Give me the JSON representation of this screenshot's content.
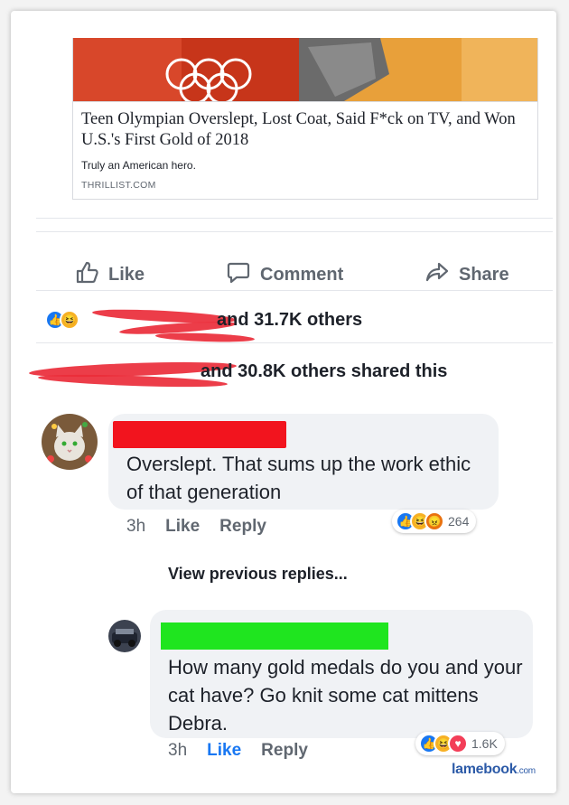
{
  "preview": {
    "headline": "Teen Olympian Overslept, Lost Coat, Said F*ck on TV, and Won U.S.'s First Gold of 2018",
    "subtitle": "Truly an American hero.",
    "domain": "THRILLIST.COM"
  },
  "actions": {
    "like": "Like",
    "comment": "Comment",
    "share": "Share"
  },
  "reactions_summary": "and 31.7K others",
  "shares_summary": "and 30.8K others shared this",
  "comments": [
    {
      "text": "Overslept.  That sums up the work ethic of that generation",
      "time": "3h",
      "like": "Like",
      "reply": "Reply",
      "reaction_count": "264",
      "reaction_icons": [
        "like-icon",
        "haha-icon",
        "angry-icon"
      ]
    }
  ],
  "view_previous": "View previous replies...",
  "reply": {
    "text": "How many gold medals do you and your cat have? Go knit some cat mittens Debra.",
    "time": "3h",
    "like": "Like",
    "reply": "Reply",
    "reaction_count": "1.6K",
    "reaction_icons": [
      "like-icon",
      "haha-icon",
      "love-icon"
    ]
  },
  "watermark": {
    "main": "lamebook",
    "suffix": ".com"
  },
  "colors": {
    "facebook_blue": "#1877f2",
    "redaction_red": "#f2141e",
    "redaction_green": "#1fe51f"
  }
}
